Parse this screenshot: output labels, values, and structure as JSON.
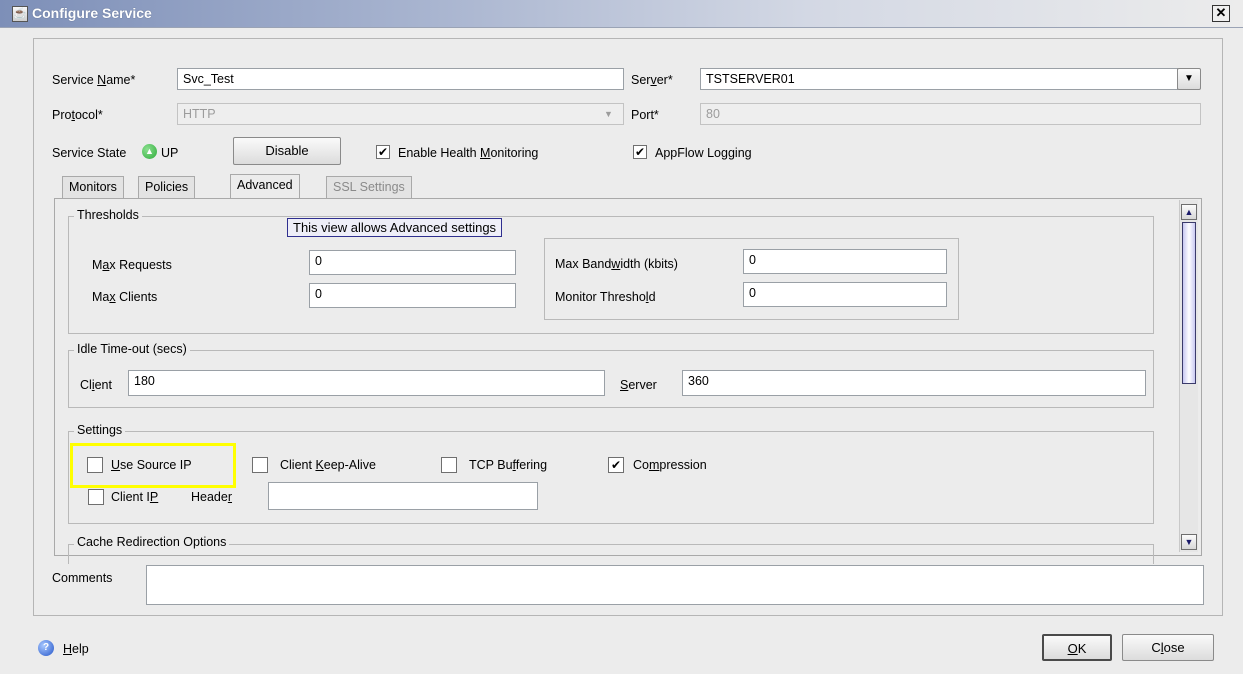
{
  "window": {
    "title": "Configure Service",
    "close_glyph": "✕",
    "app_icon": "java-app-icon"
  },
  "form": {
    "service_name_label": "Service Name*",
    "service_name_value": "Svc_Test",
    "server_label": "Server*",
    "server_value": "TSTSERVER01",
    "protocol_label": "Protocol*",
    "protocol_value": "HTTP",
    "port_label": "Port*",
    "port_value": "80",
    "service_state_label": "Service State",
    "service_state_value": "UP",
    "disable_button": "Disable",
    "enable_health_monitoring": {
      "label": "Enable Health Monitoring",
      "checked": true
    },
    "appflow_logging": {
      "label": "AppFlow Logging",
      "checked": true
    }
  },
  "tabs": [
    {
      "label": "Monitors",
      "active": false
    },
    {
      "label": "Policies",
      "active": false
    },
    {
      "label": "Advanced",
      "active": true
    },
    {
      "label": "SSL Settings",
      "active": false
    }
  ],
  "tooltip": "This view allows Advanced settings",
  "thresholds": {
    "legend": "Thresholds",
    "max_requests_label": "Max Requests",
    "max_requests_value": "0",
    "max_clients_label": "Max Clients",
    "max_clients_value": "0",
    "max_bandwidth_label": "Max Bandwidth (kbits)",
    "max_bandwidth_value": "0",
    "monitor_threshold_label": "Monitor Threshold",
    "monitor_threshold_value": "0"
  },
  "idle_timeout": {
    "legend": "Idle Time-out (secs)",
    "client_label": "Client",
    "client_value": "180",
    "server_label": "Server",
    "server_value": "360"
  },
  "settings": {
    "legend": "Settings",
    "use_source_ip": {
      "label": "Use Source IP",
      "checked": false
    },
    "client_keep_alive": {
      "label": "Client Keep-Alive",
      "checked": false
    },
    "tcp_buffering": {
      "label": "TCP Buffering",
      "checked": false
    },
    "compression": {
      "label": "Compression",
      "checked": true
    },
    "client_ip": {
      "label": "Client IP",
      "checked": false
    },
    "header_label": "Header",
    "header_value": ""
  },
  "cache_redirection": {
    "legend": "Cache Redirection Options"
  },
  "comments": {
    "label": "Comments",
    "value": ""
  },
  "footer": {
    "help": "Help",
    "ok": "OK",
    "close": "Close"
  },
  "colors": {
    "highlight": "#ffff00",
    "state_up": "#2eab3a",
    "title_gradient_start": "#7d8fb8"
  }
}
